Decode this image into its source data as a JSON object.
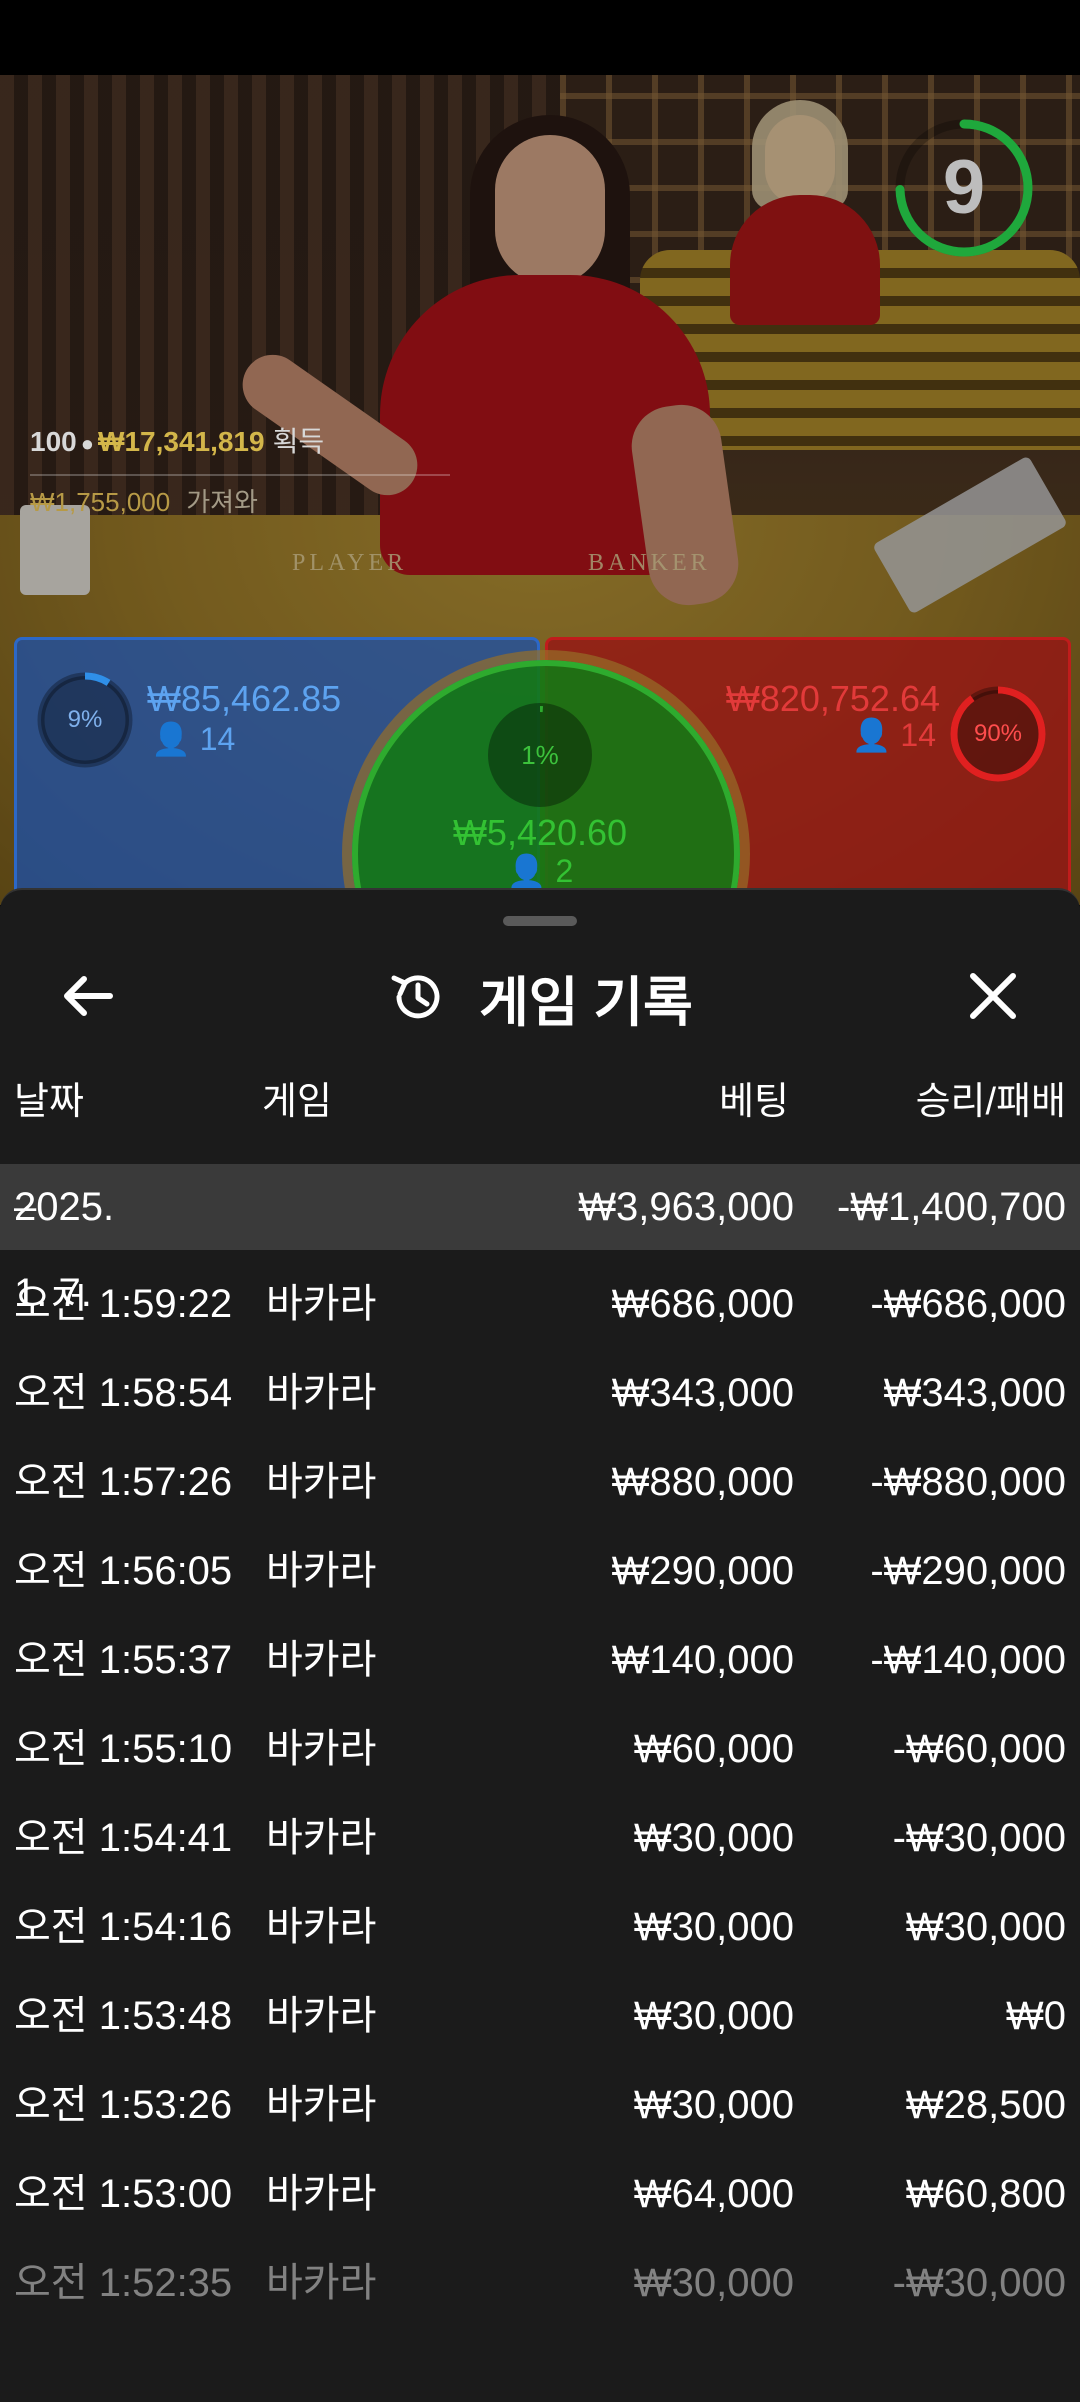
{
  "countdown": "9",
  "winners": {
    "count": "100",
    "amount": "₩17,341,819",
    "label": "획득",
    "second_amount": "₩1,755,000",
    "second_label": "가져와"
  },
  "table_labels": {
    "player": "PLAYER",
    "banker": "BANKER"
  },
  "bets": {
    "player": {
      "percent": "9%",
      "percent_value": 9,
      "amount": "₩85,462.85",
      "players": "14",
      "color": "#2c68c7"
    },
    "tie": {
      "percent": "1%",
      "percent_value": 1,
      "amount": "₩5,420.60",
      "players": "2",
      "color": "#2eab2e"
    },
    "banker": {
      "percent": "90%",
      "percent_value": 90,
      "amount": "₩820,752.64",
      "players": "14",
      "color": "#c01c1c"
    }
  },
  "sheet": {
    "title": "게임 기록",
    "back_icon": "arrow-left-icon",
    "title_icon": "history-icon",
    "close_icon": "close-icon",
    "columns": {
      "date": "날짜",
      "game": "게임",
      "bet": "베팅",
      "result": "승리/패배"
    },
    "date_group": {
      "toggle": "–",
      "date": "2025. 1. 7.",
      "bet_total": "₩3,963,000",
      "result_total": "-₩1,400,700"
    },
    "rows": [
      {
        "time": "오전 1:59:22",
        "game": "바카라",
        "bet": "₩686,000",
        "result": "-₩686,000"
      },
      {
        "time": "오전 1:58:54",
        "game": "바카라",
        "bet": "₩343,000",
        "result": "₩343,000"
      },
      {
        "time": "오전 1:57:26",
        "game": "바카라",
        "bet": "₩880,000",
        "result": "-₩880,000"
      },
      {
        "time": "오전 1:56:05",
        "game": "바카라",
        "bet": "₩290,000",
        "result": "-₩290,000"
      },
      {
        "time": "오전 1:55:37",
        "game": "바카라",
        "bet": "₩140,000",
        "result": "-₩140,000"
      },
      {
        "time": "오전 1:55:10",
        "game": "바카라",
        "bet": "₩60,000",
        "result": "-₩60,000"
      },
      {
        "time": "오전 1:54:41",
        "game": "바카라",
        "bet": "₩30,000",
        "result": "-₩30,000"
      },
      {
        "time": "오전 1:54:16",
        "game": "바카라",
        "bet": "₩30,000",
        "result": "₩30,000"
      },
      {
        "time": "오전 1:53:48",
        "game": "바카라",
        "bet": "₩30,000",
        "result": "₩0"
      },
      {
        "time": "오전 1:53:26",
        "game": "바카라",
        "bet": "₩30,000",
        "result": "₩28,500"
      },
      {
        "time": "오전 1:53:00",
        "game": "바카라",
        "bet": "₩64,000",
        "result": "₩60,800"
      },
      {
        "time": "오전 1:52:35",
        "game": "바카라",
        "bet": "₩30,000",
        "result": "-₩30,000"
      }
    ]
  }
}
